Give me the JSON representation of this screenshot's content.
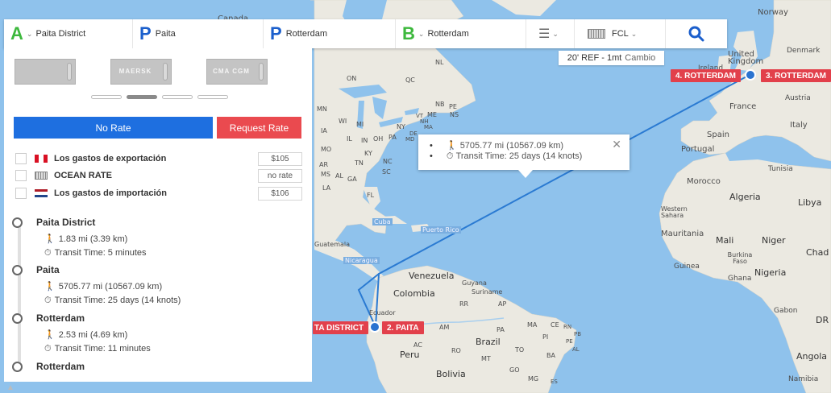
{
  "search": {
    "origin_letter": "A",
    "origin": "Paita District",
    "origin_port_letter": "P",
    "origin_port": "Paita",
    "dest_port_letter": "P",
    "dest_port": "Rotterdam",
    "dest_letter": "B",
    "destination": "Rotterdam",
    "container_type": "FCL"
  },
  "container": {
    "label": "20' REF - 1mt",
    "change": "Cambio"
  },
  "thumbnails": [
    "",
    "MAERSK",
    "CMA CGM"
  ],
  "buttons": {
    "no_rate": "No Rate",
    "request_rate": "Request Rate"
  },
  "costs": [
    {
      "label": "Los gastos de exportación",
      "value": "$105"
    },
    {
      "label": "OCEAN RATE",
      "value": "no rate"
    },
    {
      "label": "Los gastos de importación",
      "value": "$106"
    }
  ],
  "itinerary": [
    {
      "name": "Paita District",
      "distance": "1.83 mi (3.39 km)",
      "transit": "Transit Time:  5 minutes"
    },
    {
      "name": "Paita",
      "distance": "5705.77 mi (10567.09 km)",
      "transit": "Transit Time:  25 days (14 knots)"
    },
    {
      "name": "Rotterdam",
      "distance": "2.53 mi (4.69 km)",
      "transit": "Transit Time:  11 minutes"
    },
    {
      "name": "Rotterdam"
    }
  ],
  "popup": {
    "distance": "5705.77 mi (10567.09 km)",
    "transit": "Transit Time: 25 days (14 knots)"
  },
  "ports": {
    "p1": "TA DISTRICT",
    "p2": "2. PAITA",
    "p3": "3. ROTTERDAM",
    "p4": "4. ROTTERDAM"
  },
  "map_labels": {
    "canada": "Canada",
    "norway": "Norway",
    "united_kingdom": "United Kingdom",
    "ireland": "Ireland",
    "denmark": "Denmark",
    "france": "France",
    "austria": "Austria",
    "italy": "Italy",
    "spain": "Spain",
    "portugal": "Portugal",
    "tunisia": "Tunisia",
    "morocco": "Morocco",
    "algeria": "Algeria",
    "libya": "Libya",
    "western_sahara": "Western Sahara",
    "mauritania": "Mauritania",
    "mali": "Mali",
    "niger": "Niger",
    "chad": "Chad",
    "burkina_faso": "Burkina Faso",
    "guinea": "Guinea",
    "ghana": "Ghana",
    "nigeria": "Nigeria",
    "gabon": "Gabon",
    "dr": "DR",
    "angola": "Angola",
    "namibia": "Namibia",
    "cuba": "Cuba",
    "puerto_rico": "Puerto Rico",
    "guatemala": "Guatemala",
    "nicaragua": "Nicaragua",
    "venezuela": "Venezuela",
    "guyana": "Guyana",
    "suriname": "Suriname",
    "colombia": "Colombia",
    "ecuador": "Ecuador",
    "peru": "Peru",
    "brazil": "Brazil",
    "bolivia": "Bolivia",
    "on": "ON",
    "qc": "QC",
    "nb": "NB",
    "ns": "NS",
    "me": "ME",
    "ny": "NY",
    "pa": "PA",
    "oh": "OH",
    "in": "IN",
    "il": "IL",
    "ky": "KY",
    "tn": "TN",
    "nc": "NC",
    "sc": "SC",
    "ga": "GA",
    "al": "AL",
    "ms": "MS",
    "ar": "AR",
    "mo": "MO",
    "mi": "MI",
    "wi": "WI",
    "mn": "MN",
    "ia": "IA",
    "la": "LA",
    "fl": "FL",
    "nh": "NH",
    "vt": "VT",
    "ma": "MA",
    "md": "MD",
    "de": "DE",
    "nl": "NL",
    "pe_prov": "PE",
    "rr": "RR",
    "ap": "AP",
    "am": "AM",
    "pa_br": "PA",
    "ma_br": "MA",
    "ce": "CE",
    "rn": "RN",
    "pb": "PB",
    "pi": "PI",
    "ac": "AC",
    "ro": "RO",
    "to": "TO",
    "ba": "BA",
    "mt": "MT",
    "go": "GO",
    "mg": "MG",
    "pe_br": "PE",
    "al_br": "AL",
    "es": "ES"
  },
  "colors": {
    "route": "#2a7ad2",
    "port_label": "#e2404b",
    "primary_button": "#1e6fe0",
    "request_button": "#ea4a4f",
    "ocean": "#8fc2ec",
    "land": "#ebe9e1"
  }
}
